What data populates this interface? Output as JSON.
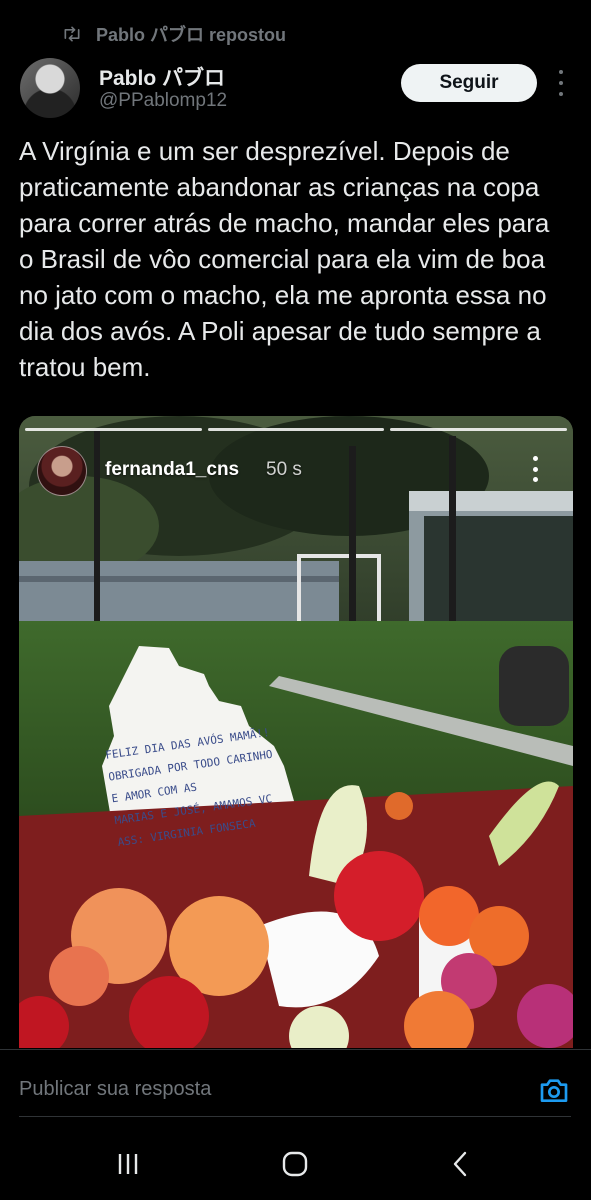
{
  "repost": {
    "label": "Pablo パブロ repostou",
    "icon": "repost-icon"
  },
  "author": {
    "name": "Pablo パブロ",
    "handle": "@PPablomp12"
  },
  "follow_button": {
    "label": "Seguir"
  },
  "tweet": {
    "text": "A Virgínia e um ser desprezível. Depois de praticamente abandonar as crianças na copa para correr atrás de macho, mandar eles para o Brasil de vôo comercial para ela vim de boa no jato com o macho, ela me apronta essa no dia dos avós. A Poli apesar de tudo sempre a tratou bem."
  },
  "media": {
    "story_user": "fernanda1_cns",
    "story_time": "50 s",
    "card_text": "Feliz dia das avós mamã!!\nObrigada por todo carinho\ne amor com as\nMarias e José, amamos vc\nAss: Virginia Fonseca"
  },
  "reply": {
    "placeholder": "Publicar sua resposta",
    "camera_icon": "camera-icon"
  },
  "colors": {
    "background": "#000000",
    "text": "#e7e9ea",
    "muted": "#71767b",
    "accent": "#1d9bf0"
  },
  "system_nav": {
    "recents_icon": "recents-icon",
    "home_icon": "home-icon",
    "back_icon": "back-icon"
  }
}
